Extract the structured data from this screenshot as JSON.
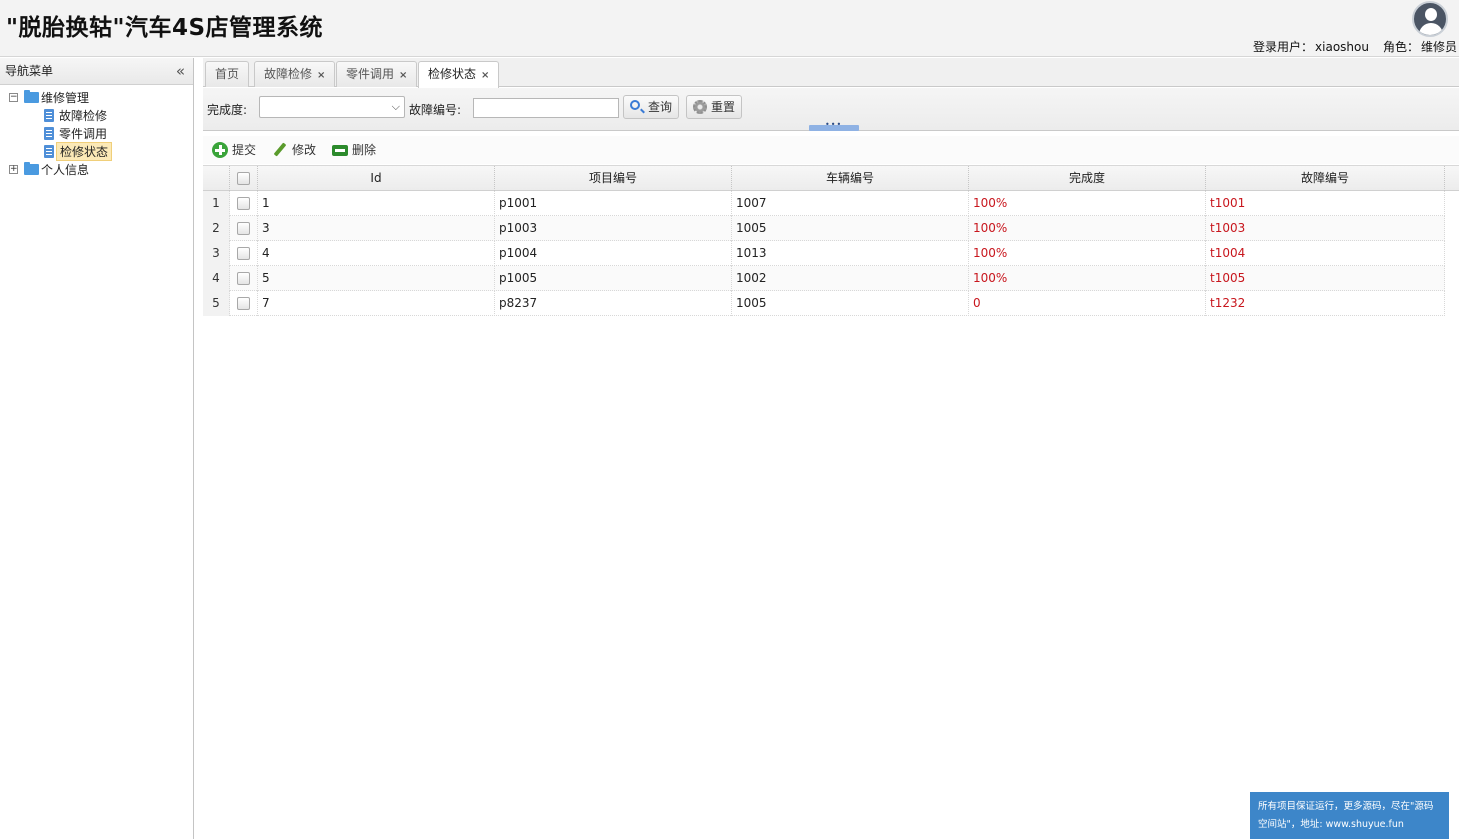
{
  "header": {
    "title": "\"脱胎换轱\"汽车4S店管理系统",
    "user_label": "登录用户：",
    "user_name": "xiaoshou",
    "role_label": "角色：",
    "role_name": "维修员"
  },
  "sidebar": {
    "title": "导航菜单",
    "tree": {
      "group1": {
        "label": "维修管理",
        "toggle": "−"
      },
      "items": [
        {
          "label": "故障检修"
        },
        {
          "label": "零件调用"
        },
        {
          "label": "检修状态"
        }
      ],
      "group2": {
        "label": "个人信息",
        "toggle": "+"
      }
    }
  },
  "tabs": [
    {
      "label": "首页"
    },
    {
      "label": "故障检修"
    },
    {
      "label": "零件调用"
    },
    {
      "label": "检修状态"
    }
  ],
  "search": {
    "completion_label": "完成度:",
    "completion_value": "",
    "fault_label": "故障编号:",
    "fault_value": "",
    "query_button": "查询",
    "reset_button": "重置"
  },
  "toolbar": {
    "submit": "提交",
    "edit": "修改",
    "delete": "删除"
  },
  "grid": {
    "columns": [
      "Id",
      "项目编号",
      "车辆编号",
      "完成度",
      "故障编号"
    ],
    "rows": [
      {
        "n": "1",
        "id": "1",
        "project": "p1001",
        "vehicle": "1007",
        "completion": "100%",
        "fault": "t1001"
      },
      {
        "n": "2",
        "id": "3",
        "project": "p1003",
        "vehicle": "1005",
        "completion": "100%",
        "fault": "t1003"
      },
      {
        "n": "3",
        "id": "4",
        "project": "p1004",
        "vehicle": "1013",
        "completion": "100%",
        "fault": "t1004"
      },
      {
        "n": "4",
        "id": "5",
        "project": "p1005",
        "vehicle": "1002",
        "completion": "100%",
        "fault": "t1005"
      },
      {
        "n": "5",
        "id": "7",
        "project": "p8237",
        "vehicle": "1005",
        "completion": "0",
        "fault": "t1232"
      }
    ]
  },
  "notice": {
    "line1": "所有项目保证运行，更多源码，尽在\"源码",
    "line2": "空间站\"，地址: www.shuyue.fun"
  }
}
